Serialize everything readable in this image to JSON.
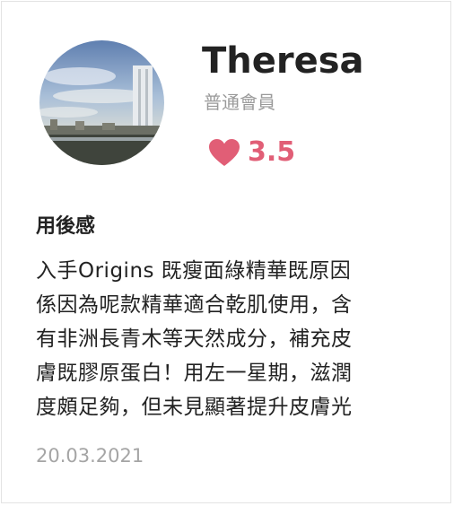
{
  "user": {
    "name": "Theresa",
    "membership": "普通會員",
    "rating": "3.5"
  },
  "review": {
    "heading": "用後感",
    "lines": [
      "入手Origins 既瘦面綠精華既原因",
      "係因為呢款精華適合乾肌使用，含",
      "有非洲長青木等天然成分，補充皮",
      "膚既膠原蛋白！用左一星期，滋潤",
      "度頗足夠，但未見顯著提升皮膚光"
    ],
    "date": "20.03.2021"
  },
  "icons": {
    "rating": "heart-icon"
  },
  "colors": {
    "accent": "#e15e76",
    "text": "#222222",
    "muted": "#a5a5a5"
  }
}
